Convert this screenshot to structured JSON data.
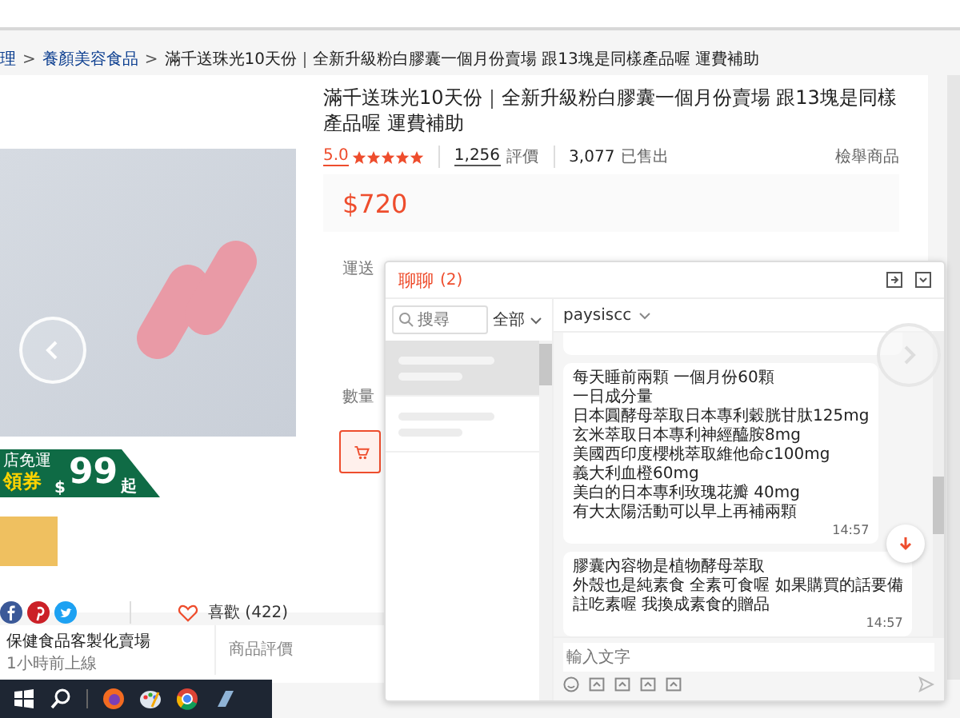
{
  "breadcrumb": {
    "separator": ">",
    "items": [
      {
        "label": "理",
        "current": false
      },
      {
        "label": "養顏美容食品",
        "current": false
      },
      {
        "label": "滿千送珠光10天份｜全新升級粉白膠囊一個月份賣場 跟13塊是同樣產品喔 運費補助",
        "current": true
      }
    ]
  },
  "product": {
    "title": "滿千送珠光10天份｜全新升級粉白膠囊一個月份賣場 跟13塊是同樣產品喔 運費補助",
    "rating": "5.0",
    "stars": 5,
    "reviews_count": "1,256",
    "reviews_label": "評價",
    "sold_count": "3,077",
    "sold_label": "已售出",
    "report": "檢舉商品",
    "price": "$720",
    "shipping_label": "運送",
    "quantity_label": "數量"
  },
  "banner": {
    "top": "店免運",
    "main": "領券",
    "currency": "$",
    "amount": "99",
    "suffix": "起"
  },
  "likes": "喜歡 (422)",
  "shop": {
    "name": "保健食品客製化賣場",
    "status": "1小時前上線",
    "reviews_tab": "商品評價"
  },
  "chat": {
    "title": "聊聊",
    "unread": "(2)",
    "search_placeholder": "搜尋",
    "filter": "全部",
    "contact": "paysiscc",
    "conversations": [
      {
        "selected": true
      },
      {
        "selected": false
      }
    ],
    "messages": [
      {
        "kind": "cropped"
      },
      {
        "kind": "text",
        "lines": [
          "每天睡前兩顆 一個月份60顆",
          "一日成分量",
          "日本圓酵母萃取日本專利穀胱甘肽125mg",
          "玄米萃取日本專利神經醯胺8mg",
          "美國西印度櫻桃萃取維他命c100mg",
          "義大利血橙60mg",
          "美白的日本專利玫瑰花瓣 40mg",
          "有大太陽活動可以早上再補兩顆"
        ],
        "time": "14:57"
      },
      {
        "kind": "text",
        "lines": [
          "膠囊內容物是植物酵母萃取",
          "外殼也是純素食 全素可食喔 如果購買的話要備",
          "註吃素喔 我換成素食的贈品"
        ],
        "time": "14:57"
      }
    ],
    "input_placeholder": "輸入文字"
  }
}
